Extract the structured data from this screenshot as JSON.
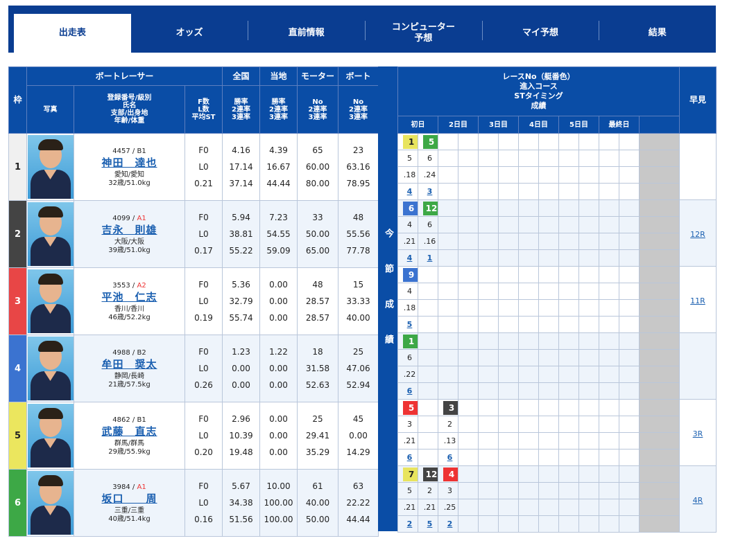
{
  "tabs": [
    {
      "label": "出走表",
      "active": true
    },
    {
      "label": "オッズ"
    },
    {
      "label": "直前情報"
    },
    {
      "label": "コンピューター\n予想"
    },
    {
      "label": "マイ予想"
    },
    {
      "label": "結果"
    }
  ],
  "header": {
    "waku": "枠",
    "boatracer": "ボートレーサー",
    "photo": "写真",
    "reg_info": "登録番号/級別\n氏名\n支部/出身地\n年齢/体重",
    "fl": "F数\nL数\n平均ST",
    "zenkoku": "全国",
    "touchi": "当地",
    "motor": "モーター",
    "boat": "ボート",
    "rate": "勝率\n2連率\n3連率",
    "nrate": "No\n2連率\n3連率",
    "race_no": "レースNo（艇番色）\n進入コース\nSTタイミング\n成績",
    "hayami": "早見",
    "konsetsu": "今節成績",
    "days": [
      "初日",
      "2日目",
      "3日目",
      "4日目",
      "5日目",
      "最終日"
    ]
  },
  "racers": [
    {
      "waku": "1",
      "color": "#f0f0f0",
      "txtcolor": "#222",
      "reg": "4457",
      "cls": "B1",
      "name": "神田　達也",
      "home": "愛知/愛知",
      "age": "32歳/51.0kg",
      "f": "F0",
      "l": "L0",
      "st": "0.21",
      "zen": [
        "4.16",
        "17.14",
        "37.14"
      ],
      "tou": [
        "4.39",
        "16.67",
        "44.44"
      ],
      "mot": [
        "65",
        "60.00",
        "80.00"
      ],
      "boa": [
        "23",
        "63.16",
        "78.95"
      ],
      "hayami": "",
      "res": [
        [
          [
            "1",
            "y"
          ],
          [
            "5",
            "g"
          ]
        ],
        [
          [
            "5",
            ""
          ],
          [
            "6",
            ""
          ]
        ],
        [
          [
            ".18",
            ""
          ],
          [
            ".24",
            ""
          ]
        ],
        [
          [
            "4",
            "l"
          ],
          [
            "3",
            "l"
          ]
        ]
      ]
    },
    {
      "waku": "2",
      "color": "#444",
      "txtcolor": "#fff",
      "reg": "4099",
      "cls": "A1",
      "name": "吉永　則雄",
      "home": "大阪/大阪",
      "age": "39歳/51.0kg",
      "f": "F0",
      "l": "L0",
      "st": "0.17",
      "zen": [
        "5.94",
        "38.81",
        "55.22"
      ],
      "tou": [
        "7.23",
        "54.55",
        "59.09"
      ],
      "mot": [
        "33",
        "50.00",
        "65.00"
      ],
      "boa": [
        "48",
        "55.56",
        "77.78"
      ],
      "hayami": "12R",
      "res": [
        [
          [
            "6",
            "b"
          ],
          [
            "12",
            "g"
          ]
        ],
        [
          [
            "4",
            ""
          ],
          [
            "6",
            ""
          ]
        ],
        [
          [
            ".21",
            ""
          ],
          [
            ".16",
            ""
          ]
        ],
        [
          [
            "4",
            "l"
          ],
          [
            "1",
            "l"
          ]
        ]
      ]
    },
    {
      "waku": "3",
      "color": "#e84646",
      "txtcolor": "#fff",
      "reg": "3553",
      "cls": "A2",
      "name": "平池　仁志",
      "home": "香川/香川",
      "age": "46歳/52.2kg",
      "f": "F0",
      "l": "L0",
      "st": "0.19",
      "zen": [
        "5.36",
        "32.79",
        "55.74"
      ],
      "tou": [
        "0.00",
        "0.00",
        "0.00"
      ],
      "mot": [
        "48",
        "28.57",
        "28.57"
      ],
      "boa": [
        "15",
        "33.33",
        "40.00"
      ],
      "hayami": "11R",
      "res": [
        [
          [
            "9",
            "b"
          ]
        ],
        [
          [
            "4",
            ""
          ]
        ],
        [
          [
            ".18",
            ""
          ]
        ],
        [
          [
            "5",
            "l"
          ]
        ]
      ]
    },
    {
      "waku": "4",
      "color": "#3b73d0",
      "txtcolor": "#fff",
      "reg": "4988",
      "cls": "B2",
      "name": "牟田　奨太",
      "home": "静岡/長崎",
      "age": "21歳/57.5kg",
      "f": "F0",
      "l": "L0",
      "st": "0.26",
      "zen": [
        "1.23",
        "0.00",
        "0.00"
      ],
      "tou": [
        "1.22",
        "0.00",
        "0.00"
      ],
      "mot": [
        "18",
        "31.58",
        "52.63"
      ],
      "boa": [
        "25",
        "47.06",
        "52.94"
      ],
      "hayami": "",
      "res": [
        [
          [
            "1",
            "g"
          ]
        ],
        [
          [
            "6",
            ""
          ]
        ],
        [
          [
            ".22",
            ""
          ]
        ],
        [
          [
            "6",
            "l"
          ]
        ]
      ]
    },
    {
      "waku": "5",
      "color": "#ebe65e",
      "txtcolor": "#222",
      "reg": "4862",
      "cls": "B1",
      "name": "武藤　直志",
      "home": "群馬/群馬",
      "age": "29歳/55.9kg",
      "f": "F0",
      "l": "L0",
      "st": "0.20",
      "zen": [
        "2.96",
        "10.39",
        "19.48"
      ],
      "tou": [
        "0.00",
        "0.00",
        "0.00"
      ],
      "mot": [
        "25",
        "29.41",
        "35.29"
      ],
      "boa": [
        "45",
        "0.00",
        "14.29"
      ],
      "hayami": "3R",
      "res": [
        [
          [
            "5",
            "r"
          ],
          [
            "",
            ""
          ],
          [
            "3",
            "k"
          ]
        ],
        [
          [
            "3",
            ""
          ],
          [
            "",
            ""
          ],
          [
            "2",
            ""
          ]
        ],
        [
          [
            ".21",
            ""
          ],
          [
            "",
            ""
          ],
          [
            ".13",
            ""
          ]
        ],
        [
          [
            "6",
            "l"
          ],
          [
            "",
            ""
          ],
          [
            "6",
            "l"
          ]
        ]
      ]
    },
    {
      "waku": "6",
      "color": "#3da846",
      "txtcolor": "#fff",
      "reg": "3984",
      "cls": "A1",
      "name": "坂口　　周",
      "home": "三重/三重",
      "age": "40歳/51.4kg",
      "f": "F0",
      "l": "L0",
      "st": "0.16",
      "zen": [
        "5.67",
        "34.38",
        "51.56"
      ],
      "tou": [
        "10.00",
        "100.00",
        "100.00"
      ],
      "mot": [
        "61",
        "40.00",
        "50.00"
      ],
      "boa": [
        "63",
        "22.22",
        "44.44"
      ],
      "hayami": "4R",
      "res": [
        [
          [
            "7",
            "y"
          ],
          [
            "12",
            "k"
          ],
          [
            "4",
            "r"
          ]
        ],
        [
          [
            "5",
            ""
          ],
          [
            "2",
            ""
          ],
          [
            "3",
            ""
          ]
        ],
        [
          [
            ".21",
            ""
          ],
          [
            ".21",
            ""
          ],
          [
            ".25",
            ""
          ]
        ],
        [
          [
            "2",
            "l"
          ],
          [
            "5",
            "l"
          ],
          [
            "2",
            "l"
          ]
        ]
      ]
    }
  ]
}
